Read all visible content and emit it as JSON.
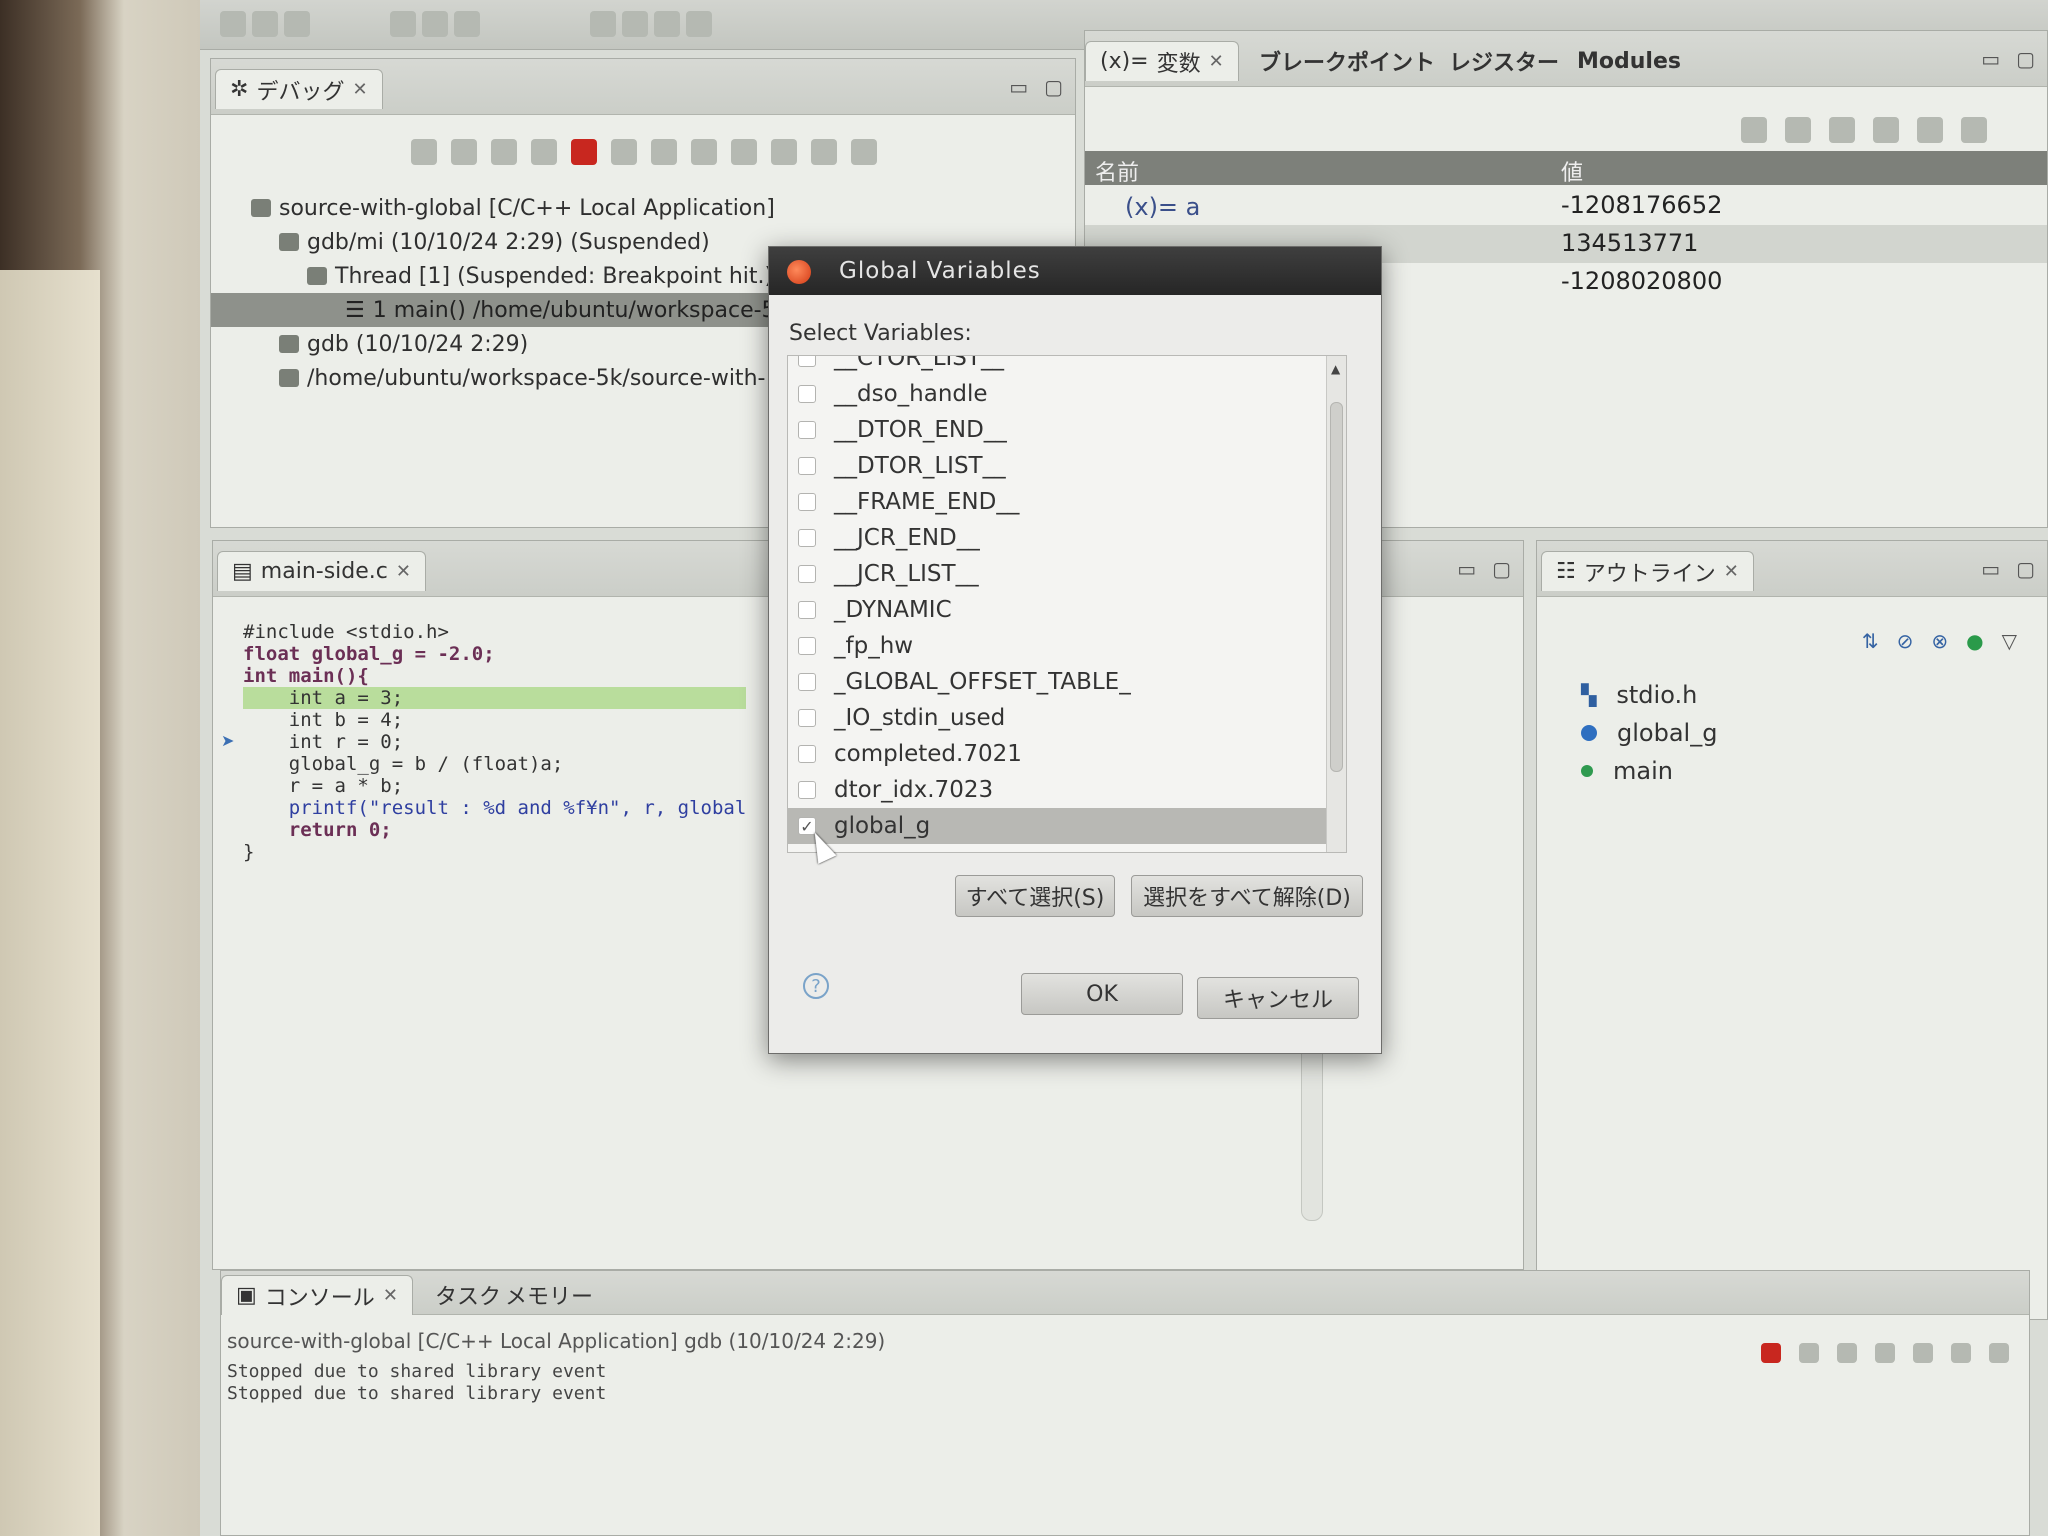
{
  "debug_panel": {
    "tab_label": "デバッグ",
    "tree": [
      "source-with-global [C/C++ Local Application]",
      "gdb/mi (10/10/24 2:29) (Suspended)",
      "Thread [1] (Suspended: Breakpoint hit.)",
      "1 main() /home/ubuntu/workspace-5",
      "gdb (10/10/24 2:29)",
      "/home/ubuntu/workspace-5k/source-with-"
    ]
  },
  "variables_panel": {
    "tabs": [
      "変数",
      "ブレークポイント",
      "レジスター",
      "Modules"
    ],
    "columns": [
      "名前",
      "値"
    ],
    "rows": [
      {
        "name": "a",
        "value": "-1208176652"
      },
      {
        "name": "",
        "value": "134513771"
      },
      {
        "name": "",
        "value": "-1208020800"
      }
    ]
  },
  "editor": {
    "tab_label": "main-side.c",
    "lines": [
      "#include <stdio.h>",
      "",
      "float global_g = -2.0;",
      "",
      "int main(){",
      "    int a = 3;",
      "    int b = 4;",
      "    int r = 0;",
      "",
      "    global_g = b / (float)a;",
      "    r = a * b;",
      "    printf(\"result : %d and %f¥n\", r, global",
      "    return 0;",
      "}"
    ]
  },
  "outline": {
    "tab_label": "アウトライン",
    "items": [
      {
        "label": "stdio.h",
        "icon": "include-icon"
      },
      {
        "label": "global_g",
        "icon": "global-variable-icon"
      },
      {
        "label": "main",
        "icon": "function-icon"
      }
    ]
  },
  "console": {
    "tabs": [
      "コンソール",
      "タスク",
      "メモリー"
    ],
    "title": "source-with-global [C/C++ Local Application] gdb (10/10/24 2:29)",
    "lines": [
      "Stopped due to shared library event",
      "Stopped due to shared library event"
    ]
  },
  "dialog": {
    "title": "Global Variables",
    "label": "Select Variables:",
    "items": [
      {
        "label": "__CTOR_LIST__",
        "checked": false
      },
      {
        "label": "__dso_handle",
        "checked": false
      },
      {
        "label": "__DTOR_END__",
        "checked": false
      },
      {
        "label": "__DTOR_LIST__",
        "checked": false
      },
      {
        "label": "__FRAME_END__",
        "checked": false
      },
      {
        "label": "__JCR_END__",
        "checked": false
      },
      {
        "label": "__JCR_LIST__",
        "checked": false
      },
      {
        "label": "_DYNAMIC",
        "checked": false
      },
      {
        "label": "_fp_hw",
        "checked": false
      },
      {
        "label": "_GLOBAL_OFFSET_TABLE_",
        "checked": false
      },
      {
        "label": "_IO_stdin_used",
        "checked": false
      },
      {
        "label": "completed.7021",
        "checked": false
      },
      {
        "label": "dtor_idx.7023",
        "checked": false
      },
      {
        "label": "global_g",
        "checked": true
      }
    ],
    "select_all": "すべて選択(S)",
    "deselect_all": "選択をすべて解除(D)",
    "ok": "OK",
    "cancel": "キャンセル"
  }
}
